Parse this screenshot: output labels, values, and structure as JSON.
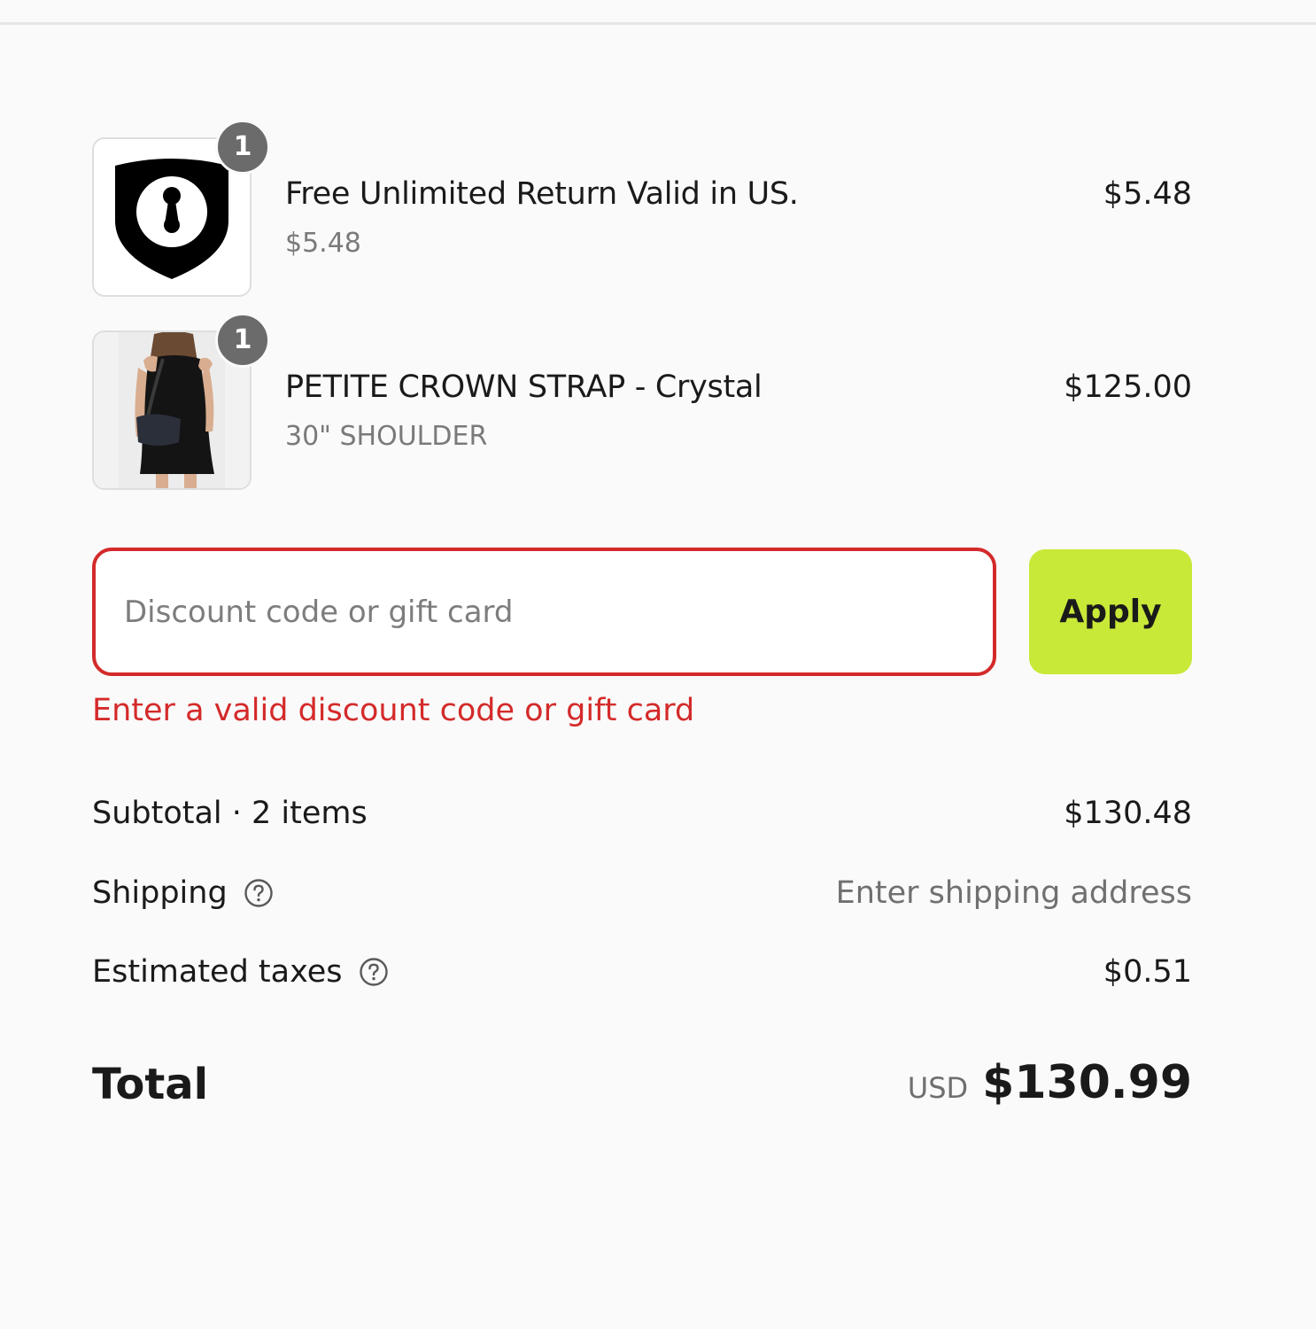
{
  "cart": {
    "items": [
      {
        "title": "Free Unlimited Return Valid in US.",
        "subtitle": "$5.48",
        "price": "$5.48",
        "quantity": "1",
        "image_icon": "shield-keyhole-icon"
      },
      {
        "title": "PETITE CROWN STRAP - Crystal",
        "subtitle": "30\" SHOULDER",
        "price": "$125.00",
        "quantity": "1",
        "image_icon": "product-photo"
      }
    ]
  },
  "discount": {
    "placeholder": "Discount code or gift card",
    "value": "",
    "apply_label": "Apply",
    "error": "Enter a valid discount code or gift card"
  },
  "costs": {
    "subtotal_label": "Subtotal · 2 items",
    "subtotal_value": "$130.48",
    "shipping_label": "Shipping",
    "shipping_value": "Enter shipping address",
    "taxes_label": "Estimated taxes",
    "taxes_value": "$0.51"
  },
  "total": {
    "label": "Total",
    "currency": "USD",
    "value": "$130.99"
  },
  "colors": {
    "accent": "#c8e938",
    "error": "#d42a2a",
    "badge": "#6b6b6b",
    "background": "#fafafa"
  }
}
